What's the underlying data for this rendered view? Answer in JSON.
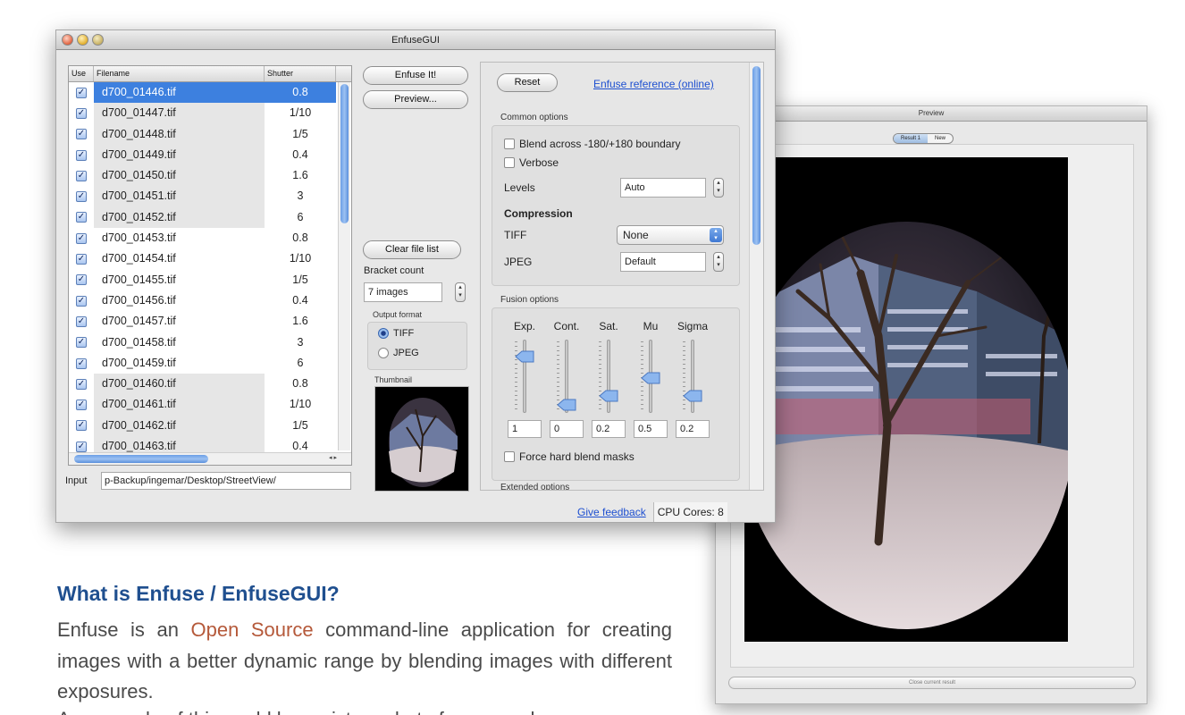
{
  "main_window": {
    "title": "EnfuseGUI",
    "file_list": {
      "headers": [
        "Use",
        "Filename",
        "Shutter"
      ],
      "rows": [
        {
          "use": true,
          "filename": "d700_01446.tif",
          "shutter": "0.8"
        },
        {
          "use": true,
          "filename": "d700_01447.tif",
          "shutter": "1/10"
        },
        {
          "use": true,
          "filename": "d700_01448.tif",
          "shutter": "1/5"
        },
        {
          "use": true,
          "filename": "d700_01449.tif",
          "shutter": "0.4"
        },
        {
          "use": true,
          "filename": "d700_01450.tif",
          "shutter": "1.6"
        },
        {
          "use": true,
          "filename": "d700_01451.tif",
          "shutter": "3"
        },
        {
          "use": true,
          "filename": "d700_01452.tif",
          "shutter": "6"
        },
        {
          "use": true,
          "filename": "d700_01453.tif",
          "shutter": "0.8"
        },
        {
          "use": true,
          "filename": "d700_01454.tif",
          "shutter": "1/10"
        },
        {
          "use": true,
          "filename": "d700_01455.tif",
          "shutter": "1/5"
        },
        {
          "use": true,
          "filename": "d700_01456.tif",
          "shutter": "0.4"
        },
        {
          "use": true,
          "filename": "d700_01457.tif",
          "shutter": "1.6"
        },
        {
          "use": true,
          "filename": "d700_01458.tif",
          "shutter": "3"
        },
        {
          "use": true,
          "filename": "d700_01459.tif",
          "shutter": "6"
        },
        {
          "use": true,
          "filename": "d700_01460.tif",
          "shutter": "0.8"
        },
        {
          "use": true,
          "filename": "d700_01461.tif",
          "shutter": "1/10"
        },
        {
          "use": true,
          "filename": "d700_01462.tif",
          "shutter": "1/5"
        },
        {
          "use": true,
          "filename": "d700_01463.tif",
          "shutter": "0.4"
        }
      ],
      "selected_index": 0
    },
    "input_label": "Input",
    "input_value": "p-Backup/ingemar/Desktop/StreetView/",
    "buttons": {
      "enfuse_it": "Enfuse It!",
      "preview": "Preview...",
      "clear_file_list": "Clear file list",
      "reset": "Reset"
    },
    "bracket_count_label": "Bracket count",
    "bracket_count_value": "7 images",
    "output_format_label": "Output format",
    "output_formats": [
      {
        "label": "TIFF",
        "selected": true
      },
      {
        "label": "JPEG",
        "selected": false
      }
    ],
    "thumbnail_label": "Thumbnail",
    "enfuse_reference_link": "Enfuse reference (online)",
    "common_options": {
      "section_label": "Common options",
      "blend_across": "Blend across -180/+180 boundary",
      "verbose": "Verbose",
      "levels_label": "Levels",
      "levels_value": "Auto",
      "compression_label": "Compression",
      "tiff_label": "TIFF",
      "tiff_value": "None",
      "jpeg_label": "JPEG",
      "jpeg_value": "Default"
    },
    "fusion_options": {
      "section_label": "Fusion options",
      "sliders": [
        {
          "label": "Exp.",
          "value": "1"
        },
        {
          "label": "Cont.",
          "value": "0"
        },
        {
          "label": "Sat.",
          "value": "0.2"
        },
        {
          "label": "Mu",
          "value": "0.5"
        },
        {
          "label": "Sigma",
          "value": "0.2"
        }
      ],
      "force_hard_blend": "Force hard blend masks"
    },
    "extended_options_label": "Extended options",
    "feedback_link": "Give feedback",
    "cpu_cores": "CPU Cores: 8"
  },
  "preview_window": {
    "title": "Preview",
    "tabs": [
      "Result 1",
      "New"
    ],
    "close_button": "Close current result"
  },
  "page": {
    "heading": "What is Enfuse / EnfuseGUI?",
    "paragraph_before_link": "Enfuse is an ",
    "open_source_link": "Open Source",
    "paragraph_after_link": " command-line application for creating images with a better dynamic range by blending images with different exposures.",
    "next_line": "An example of this could be a picture shot of a room where"
  },
  "colors": {
    "selection": "#3d80df",
    "heading": "#1f4f8f",
    "link_accent": "#b5593a",
    "ui_link": "#1d4fd0"
  }
}
